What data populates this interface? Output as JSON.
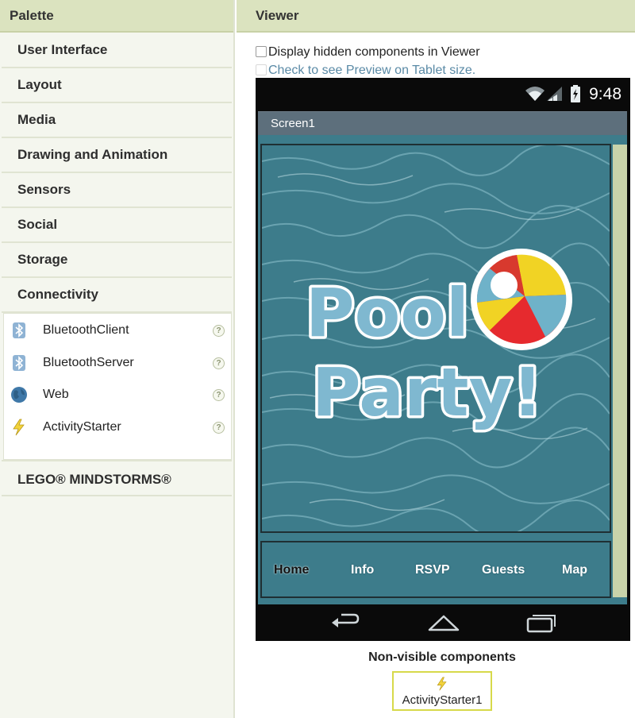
{
  "palette": {
    "title": "Palette",
    "categories": [
      "User Interface",
      "Layout",
      "Media",
      "Drawing and Animation",
      "Sensors",
      "Social",
      "Storage",
      "Connectivity"
    ],
    "components": [
      {
        "label": "BluetoothClient",
        "icon": "bluetooth-icon"
      },
      {
        "label": "BluetoothServer",
        "icon": "bluetooth-icon"
      },
      {
        "label": "Web",
        "icon": "globe-icon"
      },
      {
        "label": "ActivityStarter",
        "icon": "lightning-icon"
      }
    ],
    "help_glyph": "?",
    "lego": "LEGO® MINDSTORMS®"
  },
  "viewer": {
    "title": "Viewer",
    "display_hidden": "Display hidden components in Viewer",
    "tablet_preview": "Check to see Preview on Tablet size.",
    "phone": {
      "time": "9:48",
      "screen_title": "Screen1",
      "hero_line1": "Pool",
      "hero_line2": "Party!",
      "nav": [
        "Home",
        "Info",
        "RSVP",
        "Guests",
        "Map"
      ]
    },
    "nonvisible_title": "Non-visible components",
    "nonvisible_items": [
      "ActivityStarter1"
    ]
  },
  "colors": {
    "header_bg": "#dbe3bf",
    "palette_bg": "#f4f6ee",
    "titlebar": "#5d6f7c",
    "water": "#3d7c8b",
    "selection": "#d7d94a"
  }
}
